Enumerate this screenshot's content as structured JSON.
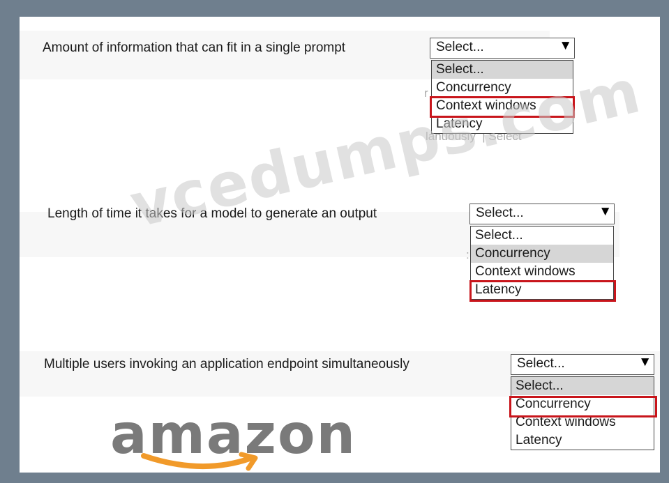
{
  "questions": [
    {
      "text": "Amount of information that can fit in a single prompt",
      "selected": "Select...",
      "options": [
        "Select...",
        "Concurrency",
        "Context windows",
        "Latency"
      ],
      "highlighted_option": "Context windows"
    },
    {
      "text": "Length of time it takes for a model to generate an output",
      "selected": "Select...",
      "options": [
        "Select...",
        "Concurrency",
        "Context windows",
        "Latency"
      ],
      "highlighted_option": "Latency"
    },
    {
      "text": "Multiple users invoking an application endpoint simultaneously",
      "selected": "Select...",
      "options": [
        "Select...",
        "Concurrency",
        "Context windows",
        "Latency"
      ],
      "highlighted_option": "Concurrency"
    }
  ],
  "dropdown_arrow": "▼",
  "watermark": "vcedumps.com",
  "logo": {
    "text": "amazon"
  },
  "colors": {
    "highlight": "#c8151b",
    "frame": "#6f7f8e",
    "grey_option": "#d6d6d6"
  }
}
